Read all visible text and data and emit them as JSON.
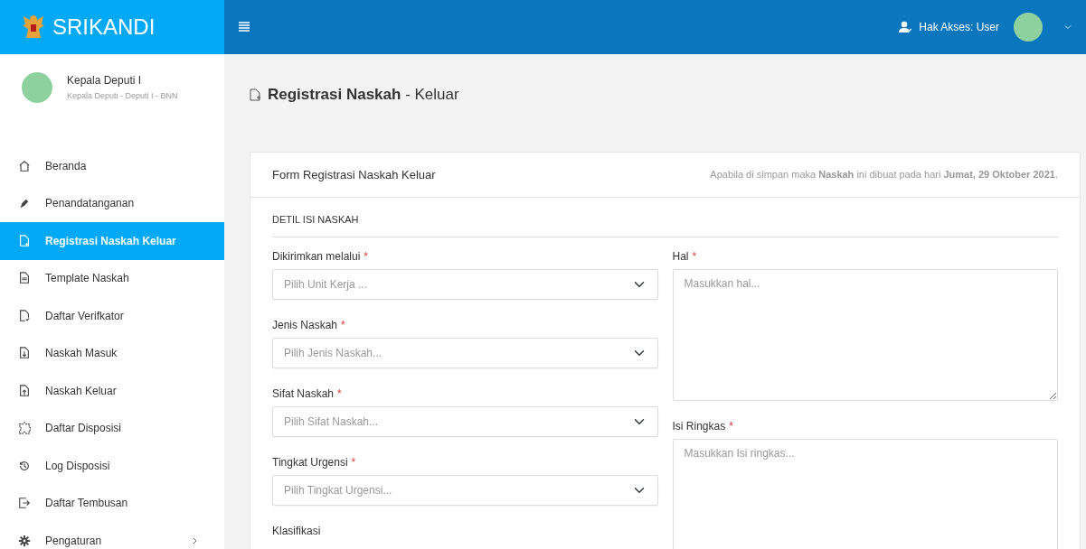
{
  "brand": {
    "name": "SRIKANDI"
  },
  "topbar": {
    "access_label": "Hak Akses: User"
  },
  "profile": {
    "name": "Kepala Deputi I",
    "role": "Kepala Deputi - Deputi I - BNN"
  },
  "sidebar": {
    "items": [
      {
        "label": "Beranda",
        "selected": false
      },
      {
        "label": "Penandatanganan",
        "selected": false
      },
      {
        "label": "Registrasi Naskah Keluar",
        "selected": true
      },
      {
        "label": "Template Naskah",
        "selected": false
      },
      {
        "label": "Daftar Verifkator",
        "selected": false
      },
      {
        "label": "Naskah Masuk",
        "selected": false
      },
      {
        "label": "Naskah Keluar",
        "selected": false
      },
      {
        "label": "Daftar Disposisi",
        "selected": false
      },
      {
        "label": "Log Disposisi",
        "selected": false
      },
      {
        "label": "Daftar Tembusan",
        "selected": false
      },
      {
        "label": "Pengaturan",
        "selected": false,
        "has_submenu": true
      }
    ]
  },
  "page": {
    "title": "**Registrasi Naskah** - Keluar"
  },
  "card": {
    "title": "Form Registrasi Naskah Keluar",
    "note": "Apabila di simpan maka **Naskah** ini dibuat pada hari **Jumat, 29 Oktober 2021**.",
    "section": "DETIL ISI NASKAH"
  },
  "left_fields": [
    {
      "label": "Dikirimkan melalui",
      "mark": "*",
      "placeholder": "Pilih Unit Kerja ..."
    },
    {
      "label": "Jenis Naskah",
      "mark": "*",
      "placeholder": "Pilih Jenis Naskah..."
    },
    {
      "label": "Sifat Naskah",
      "mark": "*",
      "placeholder": "Pilih Sifat Naskah..."
    },
    {
      "label": "Tingkat Urgensi",
      "mark": "*",
      "placeholder": "Pilih Tingkat Urgensi..."
    },
    {
      "label": "Klasifikasi"
    }
  ],
  "right_fields": [
    {
      "label": "Hal",
      "mark": "*",
      "placeholder": "Masukkan hal..."
    },
    {
      "label": "Isi Ringkas",
      "mark": "*",
      "placeholder": "Masukkan Isi ringkas..."
    }
  ]
}
